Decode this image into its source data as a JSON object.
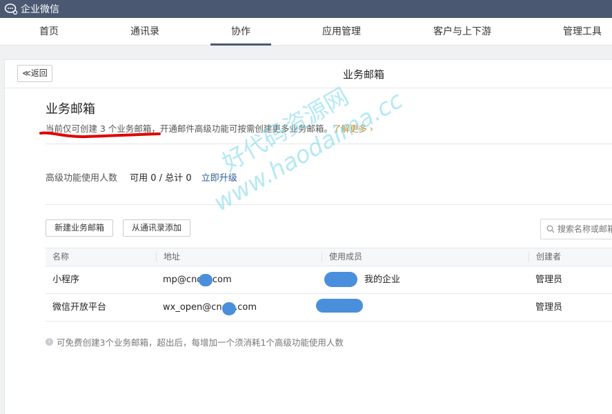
{
  "app": {
    "name": "企业微信"
  },
  "nav": {
    "items": [
      {
        "label": "首页"
      },
      {
        "label": "通讯录"
      },
      {
        "label": "协作"
      },
      {
        "label": "应用管理"
      },
      {
        "label": "客户与上下游"
      },
      {
        "label": "管理工具"
      }
    ],
    "active": "协作"
  },
  "header": {
    "back_label": "≪返回",
    "title": "业务邮箱"
  },
  "section": {
    "title": "业务邮箱",
    "desc": "当前仅可创建 3 个业务邮箱，开通邮件高级功能可按需创建更多业务邮箱。",
    "learn_more": "了解更多 ›"
  },
  "usage": {
    "label": "高级功能使用人数",
    "value": "可用 0 / 总计 0",
    "upgrade": "立即升级"
  },
  "actions": {
    "new_mailbox": "新建业务邮箱",
    "add_from_contacts": "从通讯录添加",
    "search_placeholder": "搜索名称或邮箱"
  },
  "table": {
    "columns": [
      "名称",
      "地址",
      "使用成员",
      "创建者"
    ],
    "rows": [
      {
        "name": "小程序",
        "address": "mp@cnc   c.com",
        "members": "我的企业",
        "creator": "管理员"
      },
      {
        "name": "微信开放平台",
        "address": "wx_open@cnc   c.com",
        "members": "",
        "creator": "管理员"
      }
    ]
  },
  "footnote": "可免费创建3个业务邮箱，超出后，每增加一个须消耗1个高级功能使用人数",
  "watermark": {
    "line1": "好代码资源网",
    "line2": "www.haodaima.cc"
  },
  "colors": {
    "topbar": "#4b5872",
    "link": "#2f5c9a",
    "learn_more": "#b58a3b",
    "annotation": "#e00000",
    "redaction": "#4a8fdb"
  }
}
